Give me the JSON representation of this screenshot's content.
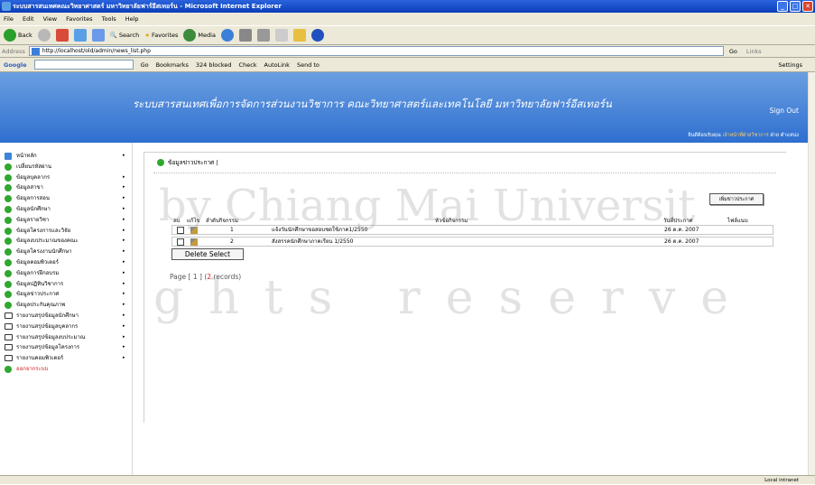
{
  "window": {
    "title": "ระบบสารสนเทศคณะวิทยาศาสตร์ มหาวิทยาลัยฟาร์อีสเทอร์น - Microsoft Internet Explorer"
  },
  "menu": [
    "File",
    "Edit",
    "View",
    "Favorites",
    "Tools",
    "Help"
  ],
  "toolbar": {
    "back": "Back",
    "search": "Search",
    "favorites": "Favorites",
    "media": "Media"
  },
  "address": {
    "label": "Address",
    "url": "http://localhost/old/admin/news_list.php",
    "go": "Go",
    "links": "Links"
  },
  "google": {
    "label": "Google",
    "go": "Go",
    "bookmarks": "Bookmarks",
    "blocked": "324 blocked",
    "check": "Check",
    "autolink": "AutoLink",
    "sendto": "Send to",
    "settings": "Settings"
  },
  "header": {
    "title": "ระบบสารสนเทศเพื่อการจัดการส่วนงานวิชาการ  คณะวิทยาศาสตร์และเทคโนโลยี  มหาวิทยาลัยฟาร์อีสเทอร์น",
    "signout": "Sign Out",
    "user_prefix": "ยินดีต้อนรับคุณ",
    "user_name": "เจ้าหน้าที่ฝ่ายวิชาการ",
    "user_suffix": "ฝ่าย ตำแหน่ง"
  },
  "sidebar": [
    {
      "label": "หน้าหลัก",
      "icon": "home",
      "arrow": true
    },
    {
      "label": "เปลี่ยนรหัสผ่าน",
      "icon": "dot",
      "arrow": false
    },
    {
      "label": "ข้อมูลบุคลากร",
      "icon": "dot",
      "arrow": true
    },
    {
      "label": "ข้อมูลสาขา",
      "icon": "dot",
      "arrow": true
    },
    {
      "label": "ข้อมูลการสอน",
      "icon": "dot",
      "arrow": true
    },
    {
      "label": "ข้อมูลนักศึกษา",
      "icon": "dot",
      "arrow": true
    },
    {
      "label": "ข้อมูลรายวิชา",
      "icon": "dot",
      "arrow": true
    },
    {
      "label": "ข้อมูลโครงการและวิจัย",
      "icon": "dot",
      "arrow": true
    },
    {
      "label": "ข้อมูลงบประมาณของคณะ",
      "icon": "dot",
      "arrow": true
    },
    {
      "label": "ข้อมูลโครงงานนักศึกษา",
      "icon": "dot",
      "arrow": true
    },
    {
      "label": "ข้อมูลคอมพิวเตอร์",
      "icon": "dot",
      "arrow": true
    },
    {
      "label": "ข้อมูลการฝึกอบรม",
      "icon": "dot",
      "arrow": true
    },
    {
      "label": "ข้อมูลปฏิทินวิชาการ",
      "icon": "dot",
      "arrow": true
    },
    {
      "label": "ข้อมูลข่าวประกาศ",
      "icon": "dot",
      "arrow": true
    },
    {
      "label": "ข้อมูลประกันคุณภาพ",
      "icon": "dot",
      "arrow": true
    },
    {
      "label": "รายงานสรุปข้อมูลนักศึกษา",
      "icon": "book",
      "arrow": true
    },
    {
      "label": "รายงานสรุปข้อมูลบุคลากร",
      "icon": "book",
      "arrow": true
    },
    {
      "label": "รายงานสรุปข้อมูลงบประมาณ",
      "icon": "book",
      "arrow": true
    },
    {
      "label": "รายงานสรุปข้อมูลโครงการ",
      "icon": "book",
      "arrow": true
    },
    {
      "label": "รายงานคอมพิวเตอร์",
      "icon": "book",
      "arrow": true
    },
    {
      "label": "ออกจากระบบ",
      "icon": "dot",
      "arrow": false,
      "red": true
    }
  ],
  "content": {
    "heading": "ข้อมูลข่าวประกาศ |",
    "add_button": "เพิ่มข่าวประกาศ",
    "columns": [
      "ลบ",
      "แก้ไข",
      "ลำดับกิจกรรม",
      "หัวข้อกิจกรรม",
      "วันที่ประกาศ",
      "ไฟล์แนบ"
    ],
    "rows": [
      {
        "no": "1",
        "title": "แจ้งวันนักศึกษาขอสอบชดใช้ภาค1/2550",
        "date": "26 ต.ค. 2007",
        "file": ""
      },
      {
        "no": "2",
        "title": "สังสรรคนักศึกษาภาคเรียน 1/2550",
        "date": "26 ต.ค. 2007",
        "file": ""
      }
    ],
    "delete_button": "Delete Select",
    "pager_prefix": "Page [ 1 ] (",
    "pager_count": "2",
    "pager_suffix": " records)"
  },
  "status": {
    "zone": "Local intranet"
  },
  "watermark": {
    "line1": "by Chiang Mai Universit",
    "line2": "ghts reserve"
  }
}
